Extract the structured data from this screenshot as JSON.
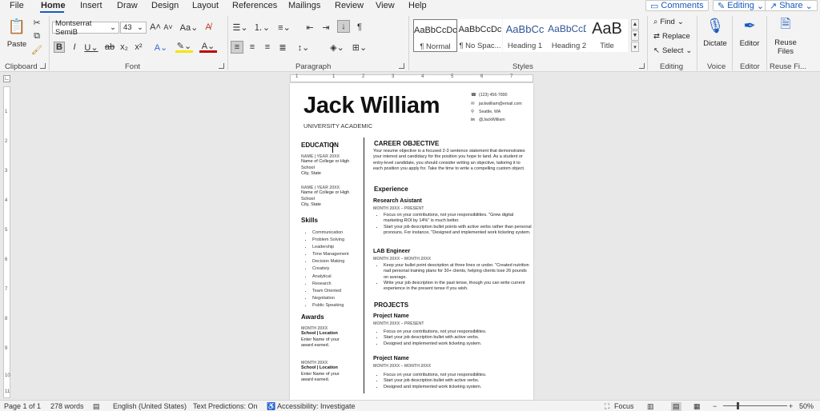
{
  "tabs": [
    "File",
    "Home",
    "Insert",
    "Draw",
    "Design",
    "Layout",
    "References",
    "Mailings",
    "Review",
    "View",
    "Help"
  ],
  "top_buttons": {
    "comments": "Comments",
    "editing": "Editing",
    "share": "Share"
  },
  "ribbon": {
    "paste_label": "Paste",
    "font_name": "Montserrat SemiB",
    "font_size": "43",
    "groups": {
      "clipboard": "Clipboard",
      "font": "Font",
      "paragraph": "Paragraph",
      "styles": "Styles",
      "editing": "Editing",
      "voice": "Voice",
      "editor": "Editor",
      "reuse": "Reuse Fi..."
    },
    "styles": [
      {
        "sample": "AaBbCcDc",
        "name": "¶ Normal"
      },
      {
        "sample": "AaBbCcDc",
        "name": "¶ No Spac..."
      },
      {
        "sample": "AaBbCc",
        "name": "Heading 1"
      },
      {
        "sample": "AaBbCcD",
        "name": "Heading 2"
      },
      {
        "sample": "AaB",
        "name": "Title"
      }
    ],
    "find": "Find",
    "replace": "Replace",
    "select": "Select",
    "dictate": "Dictate",
    "editor": "Editor",
    "reuse_files": "Reuse Files"
  },
  "ruler_numbers": [
    "1",
    "1",
    "2",
    "3",
    "4",
    "5",
    "6",
    "7"
  ],
  "vruler_numbers": [
    "1",
    "2",
    "3",
    "4",
    "5",
    "6",
    "7",
    "8",
    "9",
    "10",
    "11"
  ],
  "doc": {
    "name": "Jack William",
    "subtitle": "UNIVERSITY ACADEMIC",
    "contact": {
      "phone": "(123) 456-7890",
      "email": "jackwilliam@email.com",
      "location": "Seattle, WA",
      "linkedin": "@JackWilliam"
    },
    "education_heading": "EDUCATION",
    "education": [
      {
        "meta": "NAME | YEAR 20XX",
        "lines": [
          "Name of College or High School",
          "City, State"
        ]
      },
      {
        "meta": "NAME | YEAR 20XX",
        "lines": [
          "Name of College or High School",
          "City, State"
        ]
      }
    ],
    "skills_heading": "Skills",
    "skills": [
      "Communication",
      "Problem Solving",
      "Leadership",
      "Time Management",
      "Decision Making",
      "Creativiy",
      "Analytical",
      "Research",
      "Team Oriented",
      "Negotiation",
      "Public Speaking"
    ],
    "awards_heading": "Awards",
    "awards": [
      {
        "meta": "MONTH 20XX",
        "school": "School | Location",
        "lines": [
          "Enter Name of your",
          "award earned."
        ]
      },
      {
        "meta": "MONTH 20XX",
        "school": "School | Location",
        "lines": [
          "Enter Name of your",
          "award earned."
        ]
      }
    ],
    "objective_heading": "CAREER OBJECTIVE",
    "objective_text": "Your resume objective is a focused 2-3 sentence statement that demonstrates your interest and candidacy for the position you hope to land. As a student or entry-level candidate, you should consider writing an objective, tailoring it to each position you apply for. Take the time to write a compelling custom object.",
    "experience_heading": "Experience",
    "jobs": [
      {
        "title": "Research Asistant",
        "meta": "MONTH 20XX – PRESENT",
        "bullets": [
          "Focus on your contributions, not your responsibilities. \"Grew digital marketing ROI by 14%\" is much better.",
          "Start your job description bullet points with active verbs rather than personal pronouns. For instance, \"Designed and implemented work ticketing system."
        ]
      },
      {
        "title": "LAB Engineer",
        "meta": "MONTH 20XX – MONTH 20XX",
        "bullets": [
          "Keep your bullet point description at three lines or under. \"Created nutrition nad personal training plans for 30+ clients, helping clients lose 26 pounds on average.",
          "Write your job description in the past tense, though you can write current experience in the present tense if you wish."
        ]
      }
    ],
    "projects_heading": "PROJECTS",
    "projects": [
      {
        "title": "Project Name",
        "meta": "MONTH 20XX – PRESENT",
        "bullets": [
          "Focus on your contributions, not your responsibilites.",
          "Start your job description bullet with active verbs.",
          "Designed and implemented work ticketing system."
        ]
      },
      {
        "title": "Project Name",
        "meta": "MONTH 20XX – MONTH 20XX",
        "bullets": [
          "Focus on your contributions, not your responsibilites.",
          "Start your job description bullet with active verbs.",
          "Designed and implemented work ticketing system."
        ]
      }
    ]
  },
  "status": {
    "page": "Page 1 of 1",
    "words": "278 words",
    "language": "English (United States)",
    "predictions": "Text Predictions: On",
    "accessibility": "Accessibility: Investigate",
    "focus": "Focus",
    "zoom": "50%"
  },
  "colors": {
    "accent": "#185abd",
    "ribbon_bg": "#f3f3f3",
    "canvas_bg": "#e8e8e8"
  }
}
